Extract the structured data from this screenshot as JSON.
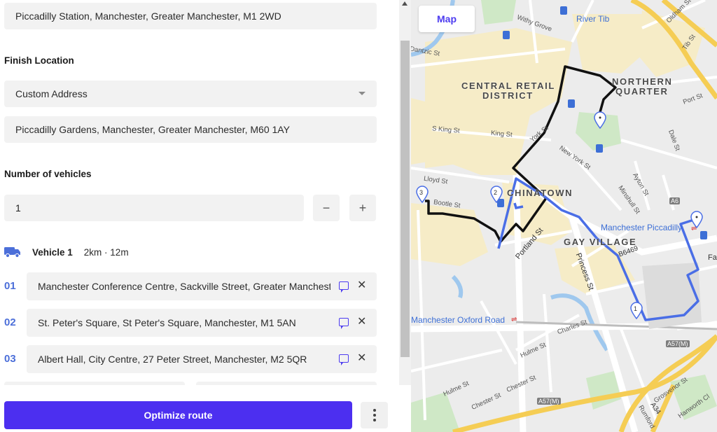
{
  "start": {
    "address": "Piccadilly Station, Manchester, Greater Manchester, M1 2WD"
  },
  "finish": {
    "label": "Finish Location",
    "mode": "Custom Address",
    "address": "Piccadilly Gardens, Manchester, Greater Manchester, M60 1AY"
  },
  "vehicles": {
    "label": "Number of vehicles",
    "count": "1",
    "decrement": "−",
    "increment": "+"
  },
  "vehicle": {
    "name": "Vehicle 1",
    "summary": "2km · 12m"
  },
  "stops": [
    {
      "num": "01",
      "address": "Manchester Conference Centre, Sackville Street, Greater Manchester"
    },
    {
      "num": "02",
      "address": "St. Peter's Square, St Peter's Square, Manchester, M1 5AN"
    },
    {
      "num": "03",
      "address": "Albert Hall, City Centre, 27 Peter Street, Manchester, M2 5QR"
    }
  ],
  "remove_glyph": "✕",
  "actions": {
    "optimize": "Optimize route"
  },
  "map": {
    "tab": "Map",
    "districts": [
      "CENTRAL RETAIL",
      "DISTRICT",
      "NORTHERN",
      "QUARTER",
      "CHINATOWN",
      "GAY VILLAGE"
    ],
    "places": [
      "River Tib",
      "Manchester Piccadilly",
      "Manchester Oxford Road"
    ],
    "streets": [
      "Withy Grove",
      "Oldham St",
      "Tib St",
      "Port St",
      "Dale St",
      "King St",
      "S King St",
      "Lloyd St",
      "Bootle St",
      "York St",
      "New York St",
      "Portland St",
      "Ayton St",
      "Minshull St",
      "Princess St",
      "Charles St",
      "Hulme St",
      "Chester St",
      "Grosvenor St",
      "Hanworth Cl",
      "Fairf",
      "Dantzic St",
      "Rumford"
    ],
    "roads": [
      "A6",
      "B6469",
      "A57(M)",
      "A34"
    ],
    "markers": [
      "1",
      "2",
      "3"
    ],
    "route_colors": {
      "vehicle": "#4a6ee6",
      "path": "#111111"
    }
  }
}
